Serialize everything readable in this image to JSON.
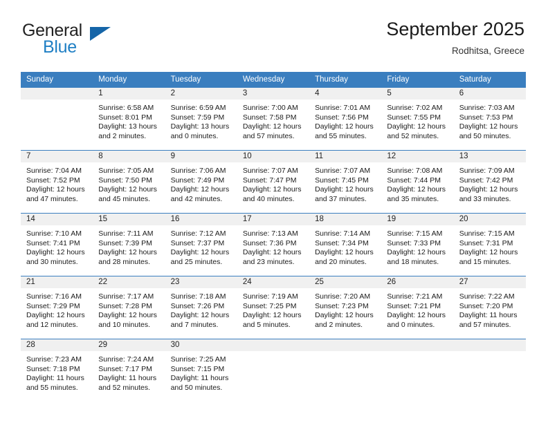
{
  "brand": {
    "name_part1": "General",
    "name_part2": "Blue",
    "logo_icon": "triangle-icon"
  },
  "header": {
    "title": "September 2025",
    "subtitle": "Rodhitsa, Greece"
  },
  "theme": {
    "header_blue": "#3a7ebf",
    "brand_blue": "#1f7fc4",
    "daynum_band": "#f0f0f0"
  },
  "weekday_headers": [
    "Sunday",
    "Monday",
    "Tuesday",
    "Wednesday",
    "Thursday",
    "Friday",
    "Saturday"
  ],
  "weeks": [
    [
      {
        "day": "",
        "empty": true,
        "sunrise": "",
        "sunset": "",
        "daylight_line1": "",
        "daylight_line2": ""
      },
      {
        "day": "1",
        "empty": false,
        "sunrise": "Sunrise: 6:58 AM",
        "sunset": "Sunset: 8:01 PM",
        "daylight_line1": "Daylight: 13 hours",
        "daylight_line2": "and 2 minutes."
      },
      {
        "day": "2",
        "empty": false,
        "sunrise": "Sunrise: 6:59 AM",
        "sunset": "Sunset: 7:59 PM",
        "daylight_line1": "Daylight: 13 hours",
        "daylight_line2": "and 0 minutes."
      },
      {
        "day": "3",
        "empty": false,
        "sunrise": "Sunrise: 7:00 AM",
        "sunset": "Sunset: 7:58 PM",
        "daylight_line1": "Daylight: 12 hours",
        "daylight_line2": "and 57 minutes."
      },
      {
        "day": "4",
        "empty": false,
        "sunrise": "Sunrise: 7:01 AM",
        "sunset": "Sunset: 7:56 PM",
        "daylight_line1": "Daylight: 12 hours",
        "daylight_line2": "and 55 minutes."
      },
      {
        "day": "5",
        "empty": false,
        "sunrise": "Sunrise: 7:02 AM",
        "sunset": "Sunset: 7:55 PM",
        "daylight_line1": "Daylight: 12 hours",
        "daylight_line2": "and 52 minutes."
      },
      {
        "day": "6",
        "empty": false,
        "sunrise": "Sunrise: 7:03 AM",
        "sunset": "Sunset: 7:53 PM",
        "daylight_line1": "Daylight: 12 hours",
        "daylight_line2": "and 50 minutes."
      }
    ],
    [
      {
        "day": "7",
        "empty": false,
        "sunrise": "Sunrise: 7:04 AM",
        "sunset": "Sunset: 7:52 PM",
        "daylight_line1": "Daylight: 12 hours",
        "daylight_line2": "and 47 minutes."
      },
      {
        "day": "8",
        "empty": false,
        "sunrise": "Sunrise: 7:05 AM",
        "sunset": "Sunset: 7:50 PM",
        "daylight_line1": "Daylight: 12 hours",
        "daylight_line2": "and 45 minutes."
      },
      {
        "day": "9",
        "empty": false,
        "sunrise": "Sunrise: 7:06 AM",
        "sunset": "Sunset: 7:49 PM",
        "daylight_line1": "Daylight: 12 hours",
        "daylight_line2": "and 42 minutes."
      },
      {
        "day": "10",
        "empty": false,
        "sunrise": "Sunrise: 7:07 AM",
        "sunset": "Sunset: 7:47 PM",
        "daylight_line1": "Daylight: 12 hours",
        "daylight_line2": "and 40 minutes."
      },
      {
        "day": "11",
        "empty": false,
        "sunrise": "Sunrise: 7:07 AM",
        "sunset": "Sunset: 7:45 PM",
        "daylight_line1": "Daylight: 12 hours",
        "daylight_line2": "and 37 minutes."
      },
      {
        "day": "12",
        "empty": false,
        "sunrise": "Sunrise: 7:08 AM",
        "sunset": "Sunset: 7:44 PM",
        "daylight_line1": "Daylight: 12 hours",
        "daylight_line2": "and 35 minutes."
      },
      {
        "day": "13",
        "empty": false,
        "sunrise": "Sunrise: 7:09 AM",
        "sunset": "Sunset: 7:42 PM",
        "daylight_line1": "Daylight: 12 hours",
        "daylight_line2": "and 33 minutes."
      }
    ],
    [
      {
        "day": "14",
        "empty": false,
        "sunrise": "Sunrise: 7:10 AM",
        "sunset": "Sunset: 7:41 PM",
        "daylight_line1": "Daylight: 12 hours",
        "daylight_line2": "and 30 minutes."
      },
      {
        "day": "15",
        "empty": false,
        "sunrise": "Sunrise: 7:11 AM",
        "sunset": "Sunset: 7:39 PM",
        "daylight_line1": "Daylight: 12 hours",
        "daylight_line2": "and 28 minutes."
      },
      {
        "day": "16",
        "empty": false,
        "sunrise": "Sunrise: 7:12 AM",
        "sunset": "Sunset: 7:37 PM",
        "daylight_line1": "Daylight: 12 hours",
        "daylight_line2": "and 25 minutes."
      },
      {
        "day": "17",
        "empty": false,
        "sunrise": "Sunrise: 7:13 AM",
        "sunset": "Sunset: 7:36 PM",
        "daylight_line1": "Daylight: 12 hours",
        "daylight_line2": "and 23 minutes."
      },
      {
        "day": "18",
        "empty": false,
        "sunrise": "Sunrise: 7:14 AM",
        "sunset": "Sunset: 7:34 PM",
        "daylight_line1": "Daylight: 12 hours",
        "daylight_line2": "and 20 minutes."
      },
      {
        "day": "19",
        "empty": false,
        "sunrise": "Sunrise: 7:15 AM",
        "sunset": "Sunset: 7:33 PM",
        "daylight_line1": "Daylight: 12 hours",
        "daylight_line2": "and 18 minutes."
      },
      {
        "day": "20",
        "empty": false,
        "sunrise": "Sunrise: 7:15 AM",
        "sunset": "Sunset: 7:31 PM",
        "daylight_line1": "Daylight: 12 hours",
        "daylight_line2": "and 15 minutes."
      }
    ],
    [
      {
        "day": "21",
        "empty": false,
        "sunrise": "Sunrise: 7:16 AM",
        "sunset": "Sunset: 7:29 PM",
        "daylight_line1": "Daylight: 12 hours",
        "daylight_line2": "and 12 minutes."
      },
      {
        "day": "22",
        "empty": false,
        "sunrise": "Sunrise: 7:17 AM",
        "sunset": "Sunset: 7:28 PM",
        "daylight_line1": "Daylight: 12 hours",
        "daylight_line2": "and 10 minutes."
      },
      {
        "day": "23",
        "empty": false,
        "sunrise": "Sunrise: 7:18 AM",
        "sunset": "Sunset: 7:26 PM",
        "daylight_line1": "Daylight: 12 hours",
        "daylight_line2": "and 7 minutes."
      },
      {
        "day": "24",
        "empty": false,
        "sunrise": "Sunrise: 7:19 AM",
        "sunset": "Sunset: 7:25 PM",
        "daylight_line1": "Daylight: 12 hours",
        "daylight_line2": "and 5 minutes."
      },
      {
        "day": "25",
        "empty": false,
        "sunrise": "Sunrise: 7:20 AM",
        "sunset": "Sunset: 7:23 PM",
        "daylight_line1": "Daylight: 12 hours",
        "daylight_line2": "and 2 minutes."
      },
      {
        "day": "26",
        "empty": false,
        "sunrise": "Sunrise: 7:21 AM",
        "sunset": "Sunset: 7:21 PM",
        "daylight_line1": "Daylight: 12 hours",
        "daylight_line2": "and 0 minutes."
      },
      {
        "day": "27",
        "empty": false,
        "sunrise": "Sunrise: 7:22 AM",
        "sunset": "Sunset: 7:20 PM",
        "daylight_line1": "Daylight: 11 hours",
        "daylight_line2": "and 57 minutes."
      }
    ],
    [
      {
        "day": "28",
        "empty": false,
        "sunrise": "Sunrise: 7:23 AM",
        "sunset": "Sunset: 7:18 PM",
        "daylight_line1": "Daylight: 11 hours",
        "daylight_line2": "and 55 minutes."
      },
      {
        "day": "29",
        "empty": false,
        "sunrise": "Sunrise: 7:24 AM",
        "sunset": "Sunset: 7:17 PM",
        "daylight_line1": "Daylight: 11 hours",
        "daylight_line2": "and 52 minutes."
      },
      {
        "day": "30",
        "empty": false,
        "sunrise": "Sunrise: 7:25 AM",
        "sunset": "Sunset: 7:15 PM",
        "daylight_line1": "Daylight: 11 hours",
        "daylight_line2": "and 50 minutes."
      },
      {
        "day": "",
        "empty": true,
        "sunrise": "",
        "sunset": "",
        "daylight_line1": "",
        "daylight_line2": ""
      },
      {
        "day": "",
        "empty": true,
        "sunrise": "",
        "sunset": "",
        "daylight_line1": "",
        "daylight_line2": ""
      },
      {
        "day": "",
        "empty": true,
        "sunrise": "",
        "sunset": "",
        "daylight_line1": "",
        "daylight_line2": ""
      },
      {
        "day": "",
        "empty": true,
        "sunrise": "",
        "sunset": "",
        "daylight_line1": "",
        "daylight_line2": ""
      }
    ]
  ]
}
